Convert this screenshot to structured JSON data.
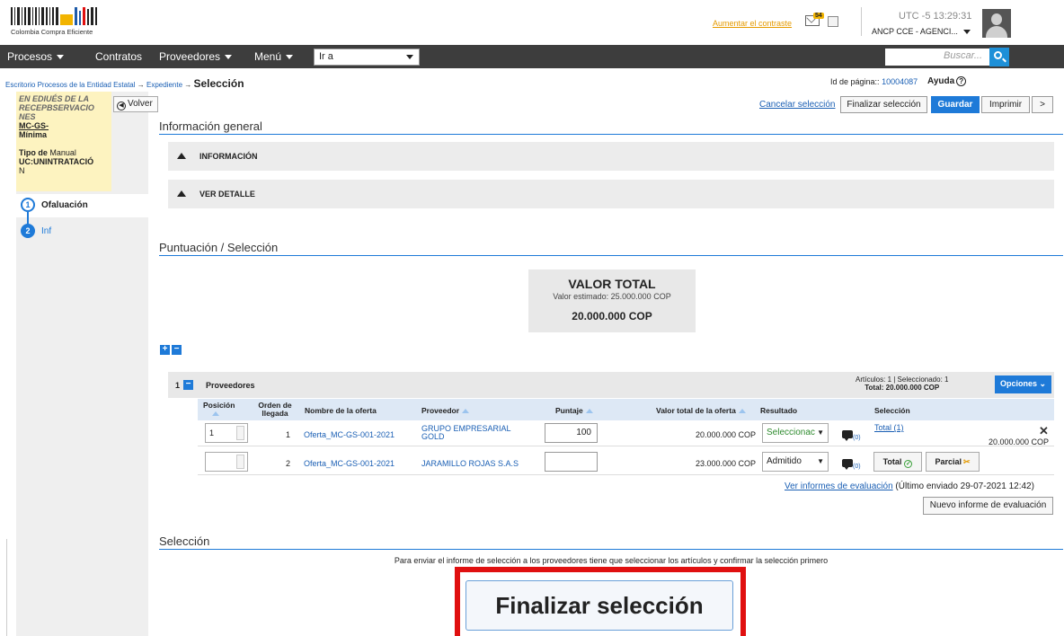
{
  "header": {
    "logo_text": "Colombia Compra Eficiente",
    "contrast_link": "Aumentar el contraste",
    "mail_count": "54",
    "utc_time": "UTC -5 13:29:31",
    "user_label": "ANCP CCE - AGENCI..."
  },
  "nav": {
    "items": [
      "Procesos",
      "Contratos",
      "Proveedores",
      "Menú"
    ],
    "goto_value": "Ir a",
    "search_placeholder": "Buscar..."
  },
  "breadcrumb": {
    "items": [
      "Escritorio",
      "Procesos de la Entidad Estatal",
      "Expediente"
    ],
    "current": "Selección",
    "arrow": "→"
  },
  "page_info": {
    "page_id_label": "Id de página::",
    "page_id": "10004087",
    "help": "Ayuda"
  },
  "sidebar": {
    "line1": "EN EDIUÉS DE LA",
    "line2": "RECEPBSERVACIO",
    "line3": "NES",
    "code": "MC-GS-",
    "minima": "Mínima",
    "tipo_label": "Tipo de",
    "tipo_value": "Manual",
    "uc": "UC:UNINTRATACIÓ",
    "uc2": "N",
    "steps": [
      {
        "num": "1",
        "label": "Ofaluación"
      },
      {
        "num": "2",
        "label": "Inf"
      }
    ],
    "back_label": "Volver"
  },
  "actions": {
    "cancel": "Cancelar selección",
    "finalize": "Finalizar selección",
    "save": "Guardar",
    "print": "Imprimir",
    "next": ">"
  },
  "info_general": {
    "title": "Información general",
    "accordions": [
      "INFORMACIÓN",
      "VER DETALLE"
    ]
  },
  "puntuacion": {
    "title": "Puntuación / Selección",
    "valor_total_title": "VALOR TOTAL",
    "valor_estimado": "Valor estimado: 25.000.000 COP",
    "valor_total": "20.000.000 COP"
  },
  "table": {
    "group_num": "1",
    "group_title": "Proveedores",
    "articles_line1": "Artículos: 1  |  Seleccionado: 1",
    "articles_line2": "Total: 20.000.000 COP",
    "options": "Opciones",
    "columns": [
      "Posición",
      "Orden de llegada",
      "Nombre de la oferta",
      "Proveedor",
      "Puntaje",
      "Valor total de la oferta",
      "Resultado",
      "Selección"
    ],
    "rows": [
      {
        "posicion": "1",
        "orden": "1",
        "oferta": "Oferta_MC-GS-001-2021",
        "proveedor_l1": "GRUPO EMPRESARIAL",
        "proveedor_l2": "GOLD",
        "puntaje": "100",
        "valor": "20.000.000 COP",
        "resultado": "Seleccionac",
        "comments": "(0)",
        "seleccion_link": "Total (1)",
        "seleccion_value": "20.000.000 COP"
      },
      {
        "posicion": "",
        "orden": "2",
        "oferta": "Oferta_MC-GS-001-2021",
        "proveedor_l1": "JARAMILLO ROJAS S.A.S",
        "proveedor_l2": "",
        "puntaje": "",
        "valor": "23.000.000 COP",
        "resultado": "Admitido",
        "comments": "(0)",
        "btn_total": "Total",
        "btn_parcial": "Parcial"
      }
    ]
  },
  "informes": {
    "link": "Ver informes de evaluación",
    "last_sent": "(Último enviado 29-07-2021 12:42)",
    "new_report": "Nuevo informe de evaluación"
  },
  "seleccion": {
    "title": "Selección",
    "note": "Para enviar el informe de selección a los proveedores tiene que seleccionar los artículos y confirmar la selección primero",
    "big_button": "Finalizar selección"
  },
  "colors": {
    "accent": "#1e7ad8",
    "nav_bg": "#3d3d3d",
    "highlight_border": "#e01010",
    "sidebar_note_bg": "#fdf3c0"
  }
}
